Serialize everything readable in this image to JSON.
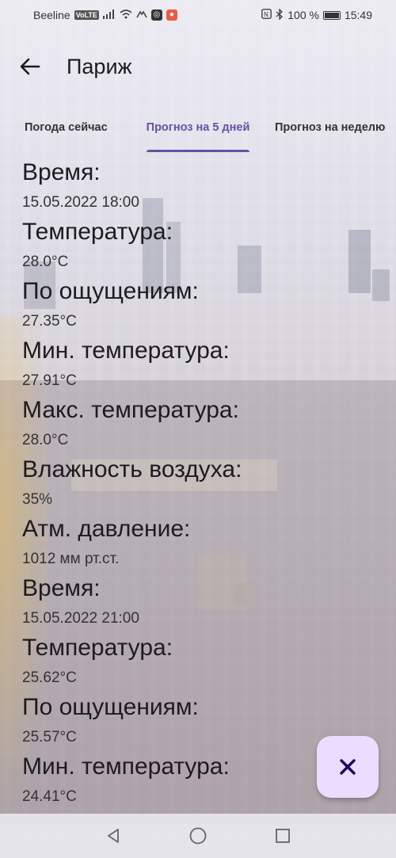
{
  "status_bar": {
    "carrier": "Beeline",
    "network_badge": "VoLTE",
    "battery_percent": "100 %",
    "time": "15:49",
    "icons": [
      "signal-icon",
      "wifi-icon",
      "app-icon",
      "app-icon",
      "map-pin-icon",
      "nfc-icon",
      "bluetooth-icon",
      "battery-icon"
    ]
  },
  "app_bar": {
    "title": "Париж",
    "back_icon": "arrow-left-icon"
  },
  "tabs": [
    {
      "label": "Погода сейчас",
      "active": false
    },
    {
      "label": "Прогноз на 5 дней",
      "active": true
    },
    {
      "label": "Прогноз на неделю",
      "active": false
    }
  ],
  "forecast_items": [
    {
      "label": "Время:",
      "value": "15.05.2022 18:00"
    },
    {
      "label": "Температура:",
      "value": "28.0°C"
    },
    {
      "label": "По ощущениям:",
      "value": "27.35°C"
    },
    {
      "label": "Мин. температура:",
      "value": "27.91°C"
    },
    {
      "label": "Макс. температура:",
      "value": "28.0°C"
    },
    {
      "label": "Влажность воздуха:",
      "value": "35%"
    },
    {
      "label": "Атм. давление:",
      "value": "1012 мм рт.ст."
    },
    {
      "label": "Время:",
      "value": "15.05.2022 21:00"
    },
    {
      "label": "Температура:",
      "value": "25.62°C"
    },
    {
      "label": "По ощущениям:",
      "value": "25.57°C"
    },
    {
      "label": "Мин. температура:",
      "value": "24.41°C"
    }
  ],
  "fab": {
    "icon": "close-icon"
  },
  "nav_bar": {
    "icons": [
      "back-triangle-icon",
      "home-circle-icon",
      "recents-square-icon"
    ]
  },
  "colors": {
    "accent": "#6750a4",
    "fab_bg": "#eaddff",
    "text": "#1c1b1f",
    "fab_icon": "#21005d"
  }
}
